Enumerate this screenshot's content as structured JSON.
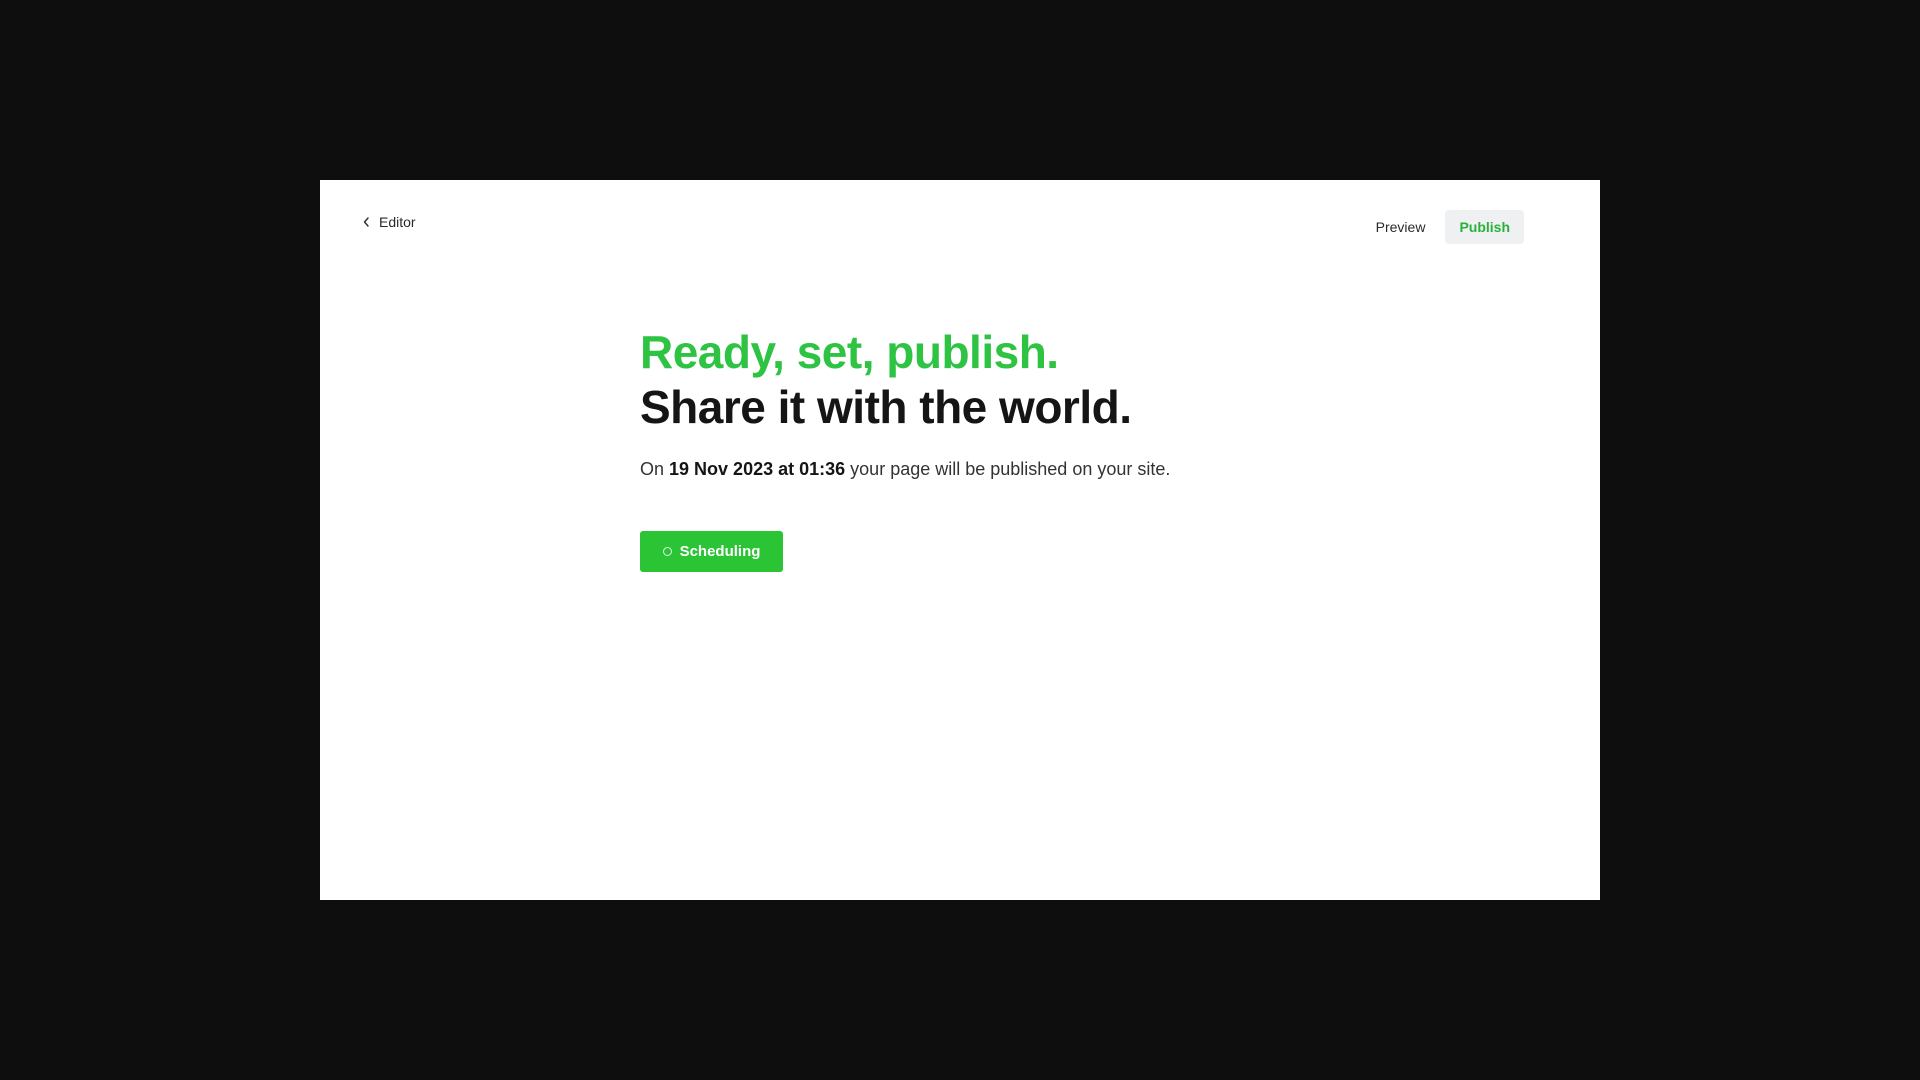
{
  "topbar": {
    "back_label": "Editor",
    "back_icon": "chevron-left-icon",
    "preview_label": "Preview",
    "publish_label": "Publish"
  },
  "main": {
    "headline_primary": "Ready, set, publish.",
    "headline_secondary": "Share it with the world.",
    "description_prefix": "On",
    "scheduled_datetime": "19 Nov 2023 at 01:36",
    "description_suffix": "your page will be published on your site.",
    "schedule_button_label": "Scheduling",
    "schedule_button_icon": "spinner-icon"
  },
  "colors": {
    "accent_green": "#2ec343",
    "publish_text_green": "#2bb03c",
    "button_green": "#2bc435",
    "backdrop": "#0e0e0f"
  }
}
